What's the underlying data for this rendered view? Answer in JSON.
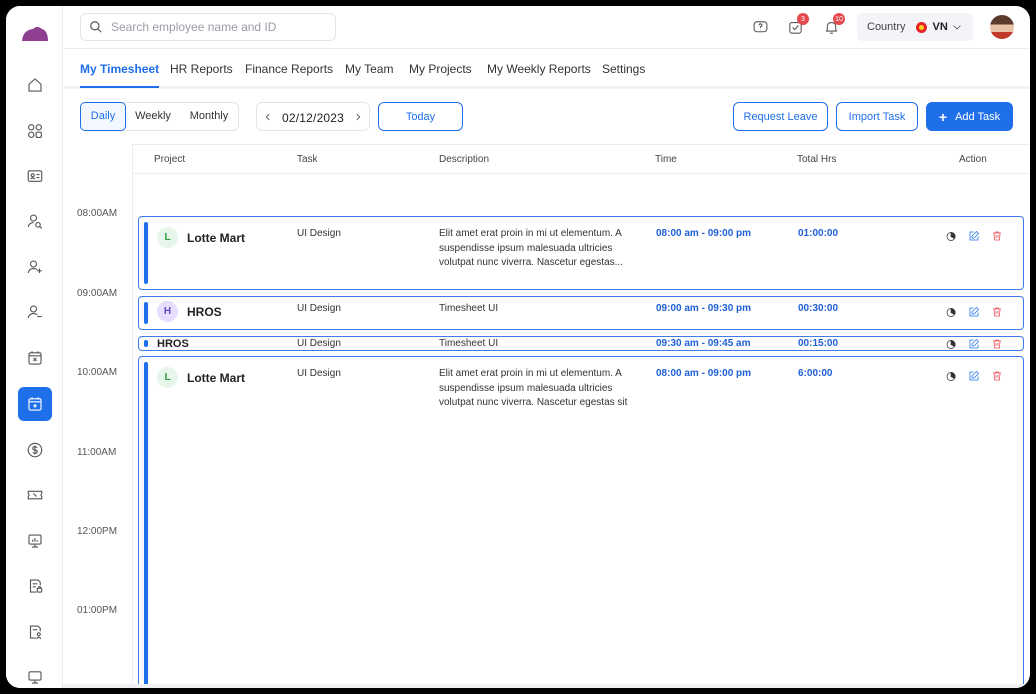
{
  "search": {
    "placeholder": "Search employee name and ID"
  },
  "top": {
    "badge_tasks": "3",
    "badge_notifications": "10",
    "country_label": "Country",
    "country_code": "VN"
  },
  "tabs": [
    "My Timesheet",
    "HR Reports",
    "Finance Reports",
    "My Team",
    "My Projects",
    "My Weekly Reports",
    "Settings"
  ],
  "view": {
    "daily": "Daily",
    "weekly": "Weekly",
    "monthly": "Monthly"
  },
  "date": "02/12/2023",
  "buttons": {
    "today": "Today",
    "request_leave": "Request Leave",
    "import_task": "Import Task",
    "add_task": "Add Task"
  },
  "columns": [
    "Project",
    "Task",
    "Description",
    "Time",
    "Total Hrs",
    "Action"
  ],
  "times": [
    "08:00AM",
    "09:00AM",
    "10:00AM",
    "11:00AM",
    "12:00PM",
    "01:00PM"
  ],
  "entries": [
    {
      "initial": "L",
      "project": "Lotte Mart",
      "task": "UI Design",
      "description": "Elit amet erat proin in mi ut elementum. A suspendisse ipsum malesuada ultricies volutpat nunc viverra. Nascetur egestas...",
      "time": "08:00 am - 09:00 pm",
      "total": "01:00:00"
    },
    {
      "initial": "H",
      "project": "HROS",
      "task": "UI Design",
      "description": "Timesheet UI",
      "time": "09:00 am - 09:30 pm",
      "total": "00:30:00"
    },
    {
      "initial": "",
      "project": "HROS",
      "task": "UI Design",
      "description": "Timesheet UI",
      "time": "09:30 am - 09:45 am",
      "total": "00:15:00"
    },
    {
      "initial": "L",
      "project": "Lotte Mart",
      "task": "UI Design",
      "description": "Elit amet erat proin in mi ut elementum. A suspendisse ipsum malesuada ultricies volutpat nunc viverra. Nascetur egestas sit",
      "time": "08:00 am - 09:00 pm",
      "total": "6:00:00"
    }
  ],
  "colors": {
    "accent": "#1f6feb",
    "danger": "#e5484d",
    "brand": "#8e3f8f"
  }
}
